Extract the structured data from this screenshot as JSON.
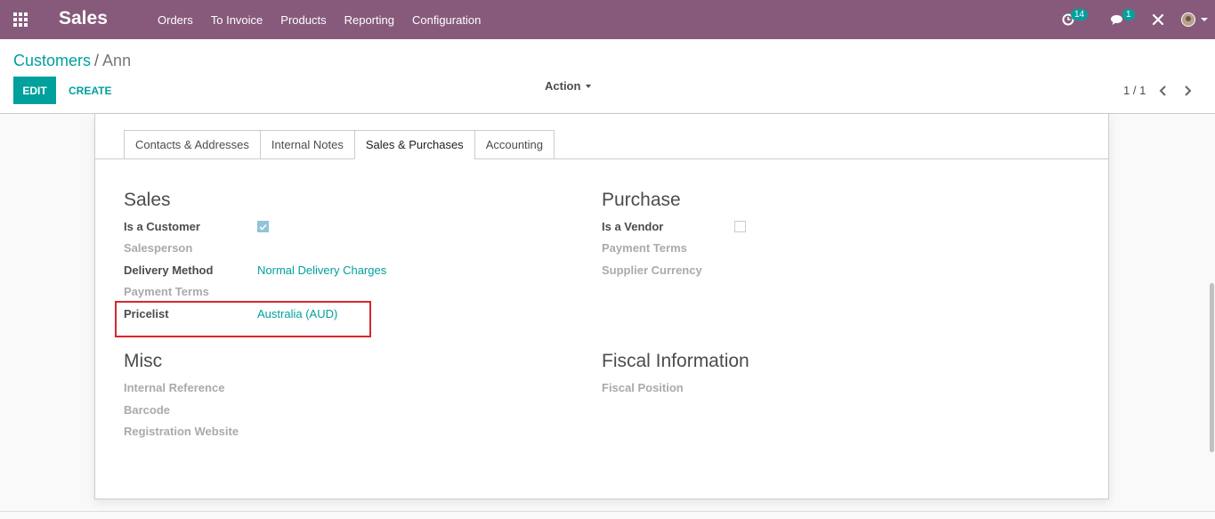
{
  "navbar": {
    "brand": "Sales",
    "menu": [
      "Orders",
      "To Invoice",
      "Products",
      "Reporting",
      "Configuration"
    ],
    "activity_count": "14",
    "message_count": "1"
  },
  "breadcrumb": {
    "parent": "Customers",
    "separator": "/",
    "current": "Ann"
  },
  "toolbar": {
    "edit_label": "EDIT",
    "create_label": "CREATE",
    "action_label": "Action",
    "pager": "1 / 1"
  },
  "tabs": [
    "Contacts & Addresses",
    "Internal Notes",
    "Sales & Purchases",
    "Accounting"
  ],
  "active_tab": "Sales & Purchases",
  "sales": {
    "title": "Sales",
    "is_customer_label": "Is a Customer",
    "is_customer": true,
    "salesperson_label": "Salesperson",
    "delivery_method_label": "Delivery Method",
    "delivery_method": "Normal Delivery Charges",
    "payment_terms_label": "Payment Terms",
    "pricelist_label": "Pricelist",
    "pricelist": "Australia (AUD)"
  },
  "purchase": {
    "title": "Purchase",
    "is_vendor_label": "Is a Vendor",
    "is_vendor": false,
    "payment_terms_label": "Payment Terms",
    "supplier_currency_label": "Supplier Currency"
  },
  "misc": {
    "title": "Misc",
    "internal_reference_label": "Internal Reference",
    "barcode_label": "Barcode",
    "registration_website_label": "Registration Website"
  },
  "fiscal": {
    "title": "Fiscal Information",
    "fiscal_position_label": "Fiscal Position"
  },
  "colors": {
    "navbar": "#875a7b",
    "accent": "#00a09d",
    "highlight": "#d9262e"
  }
}
